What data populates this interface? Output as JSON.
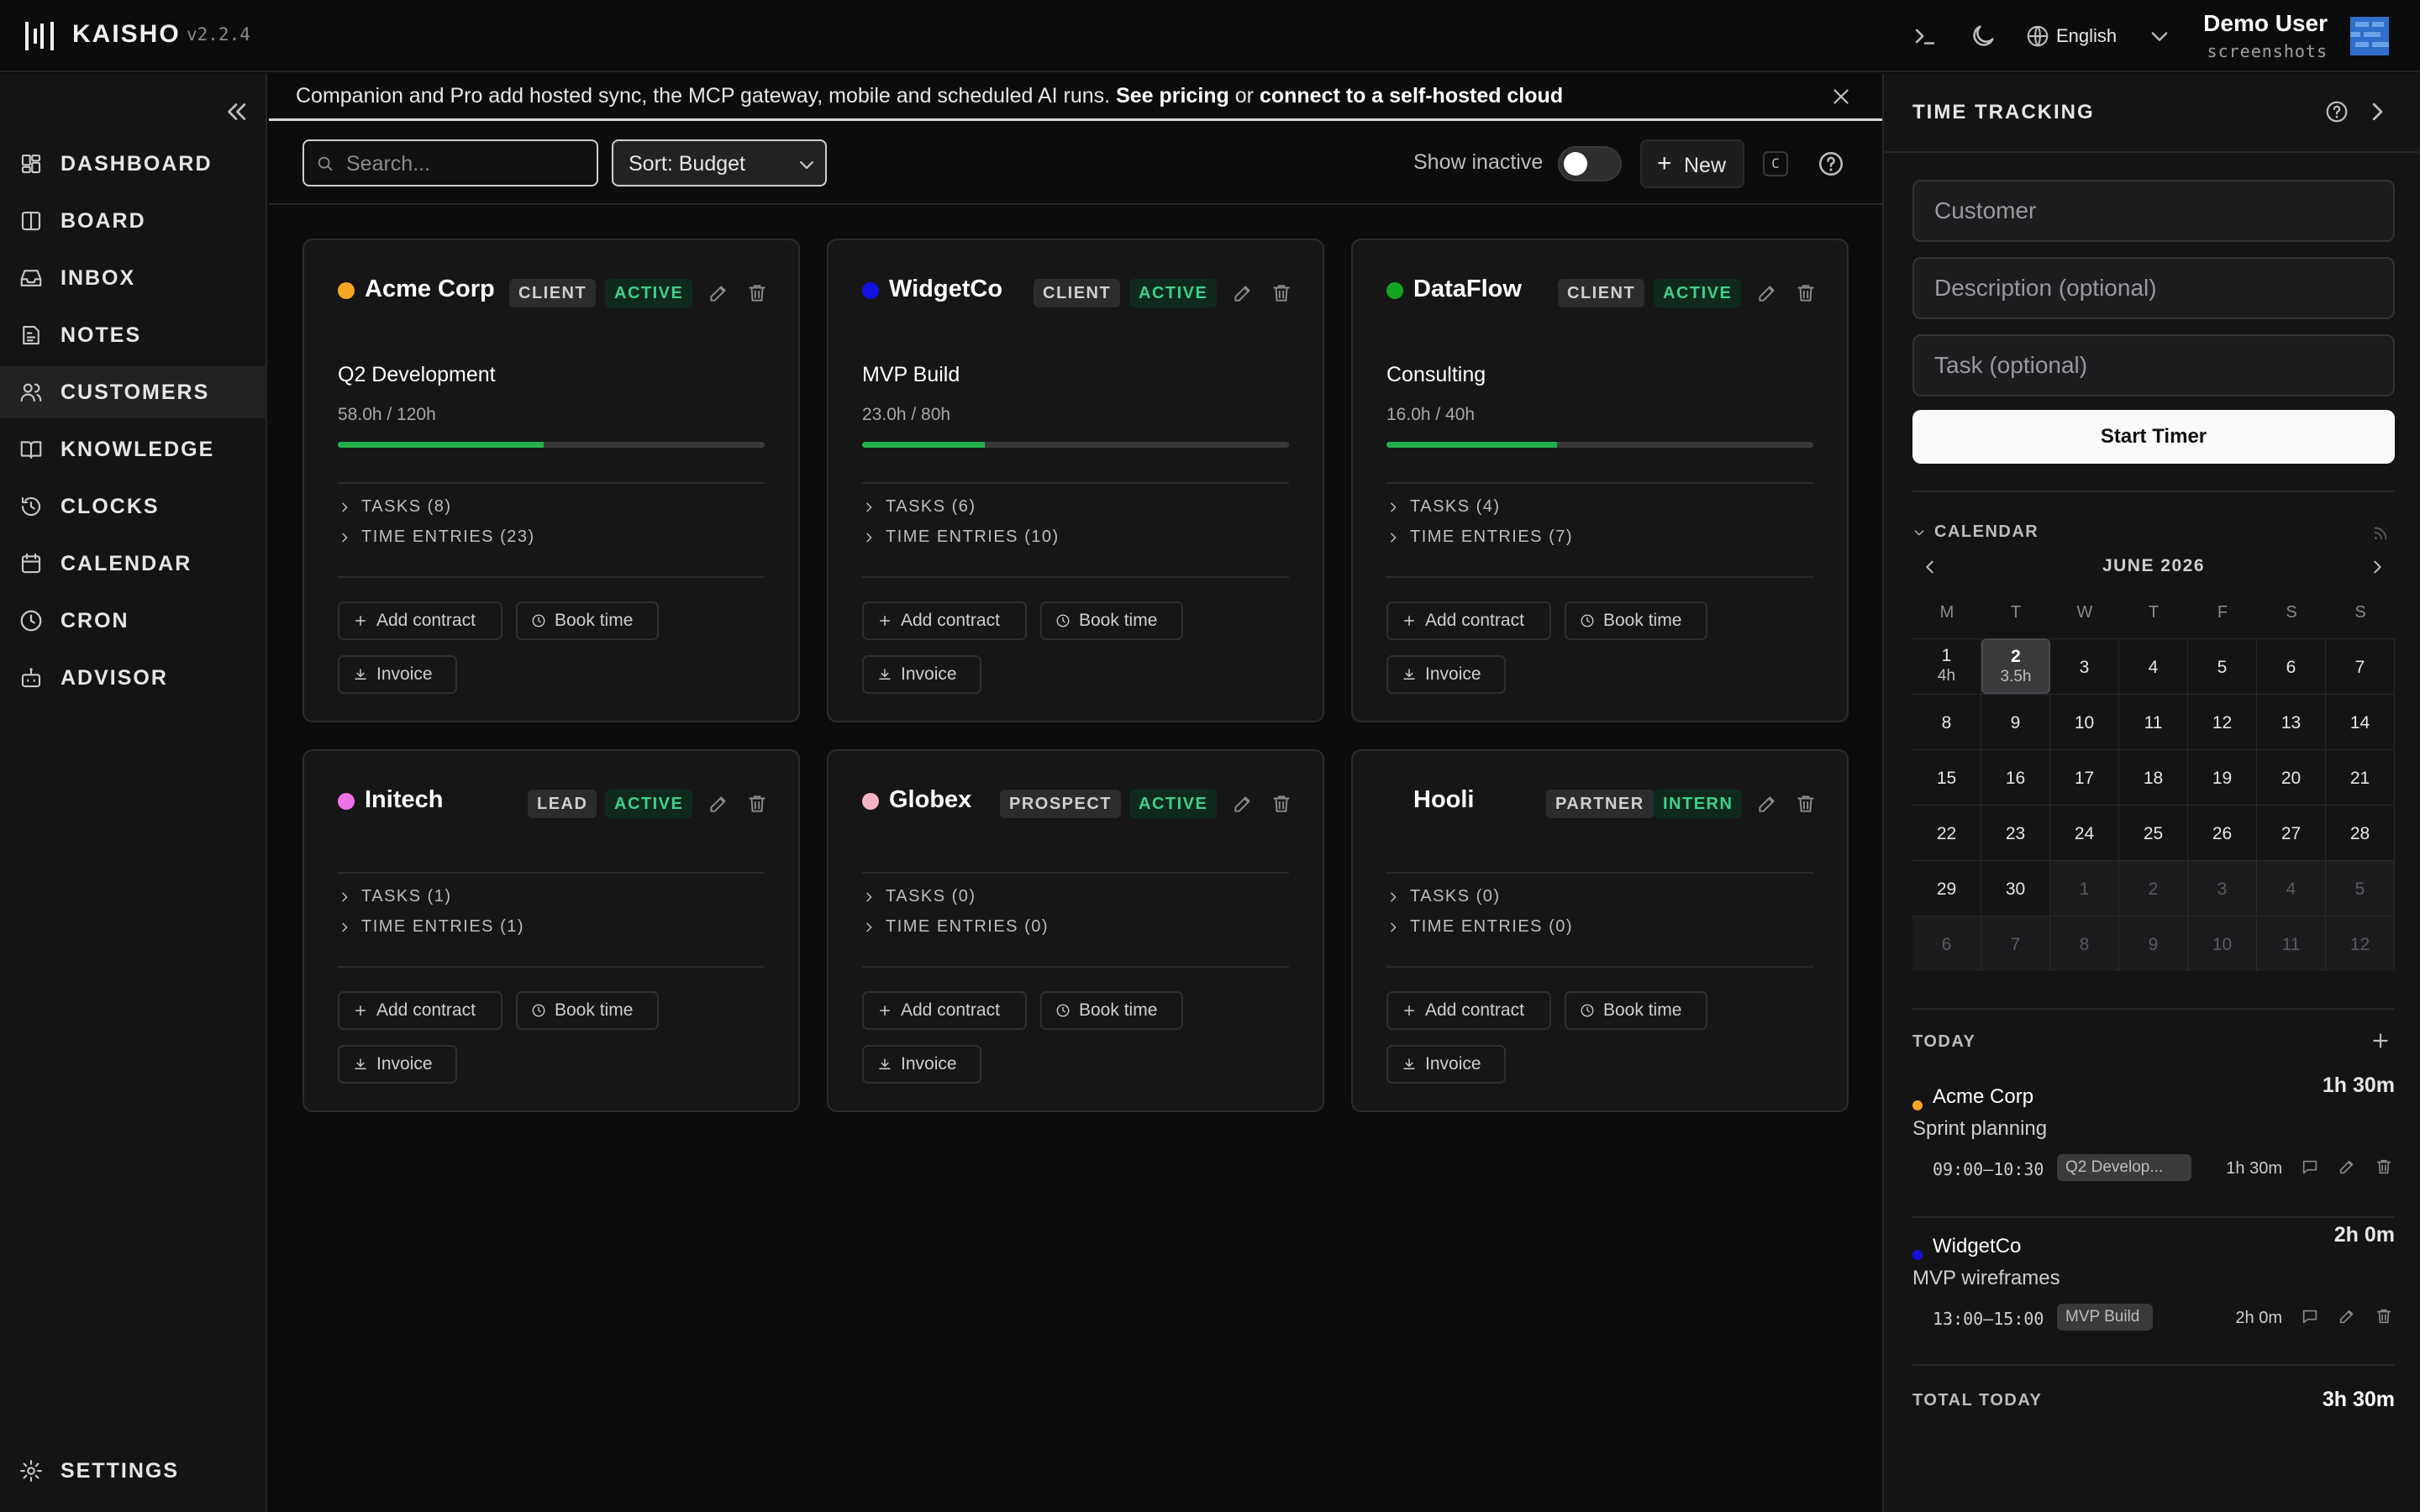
{
  "app": {
    "name": "KAISHO",
    "version": "v2.2.4"
  },
  "topbar": {
    "language": "English",
    "user_name": "Demo User",
    "user_sub": "screenshots"
  },
  "sidebar": {
    "items": [
      {
        "label": "DASHBOARD",
        "icon": "dashboard-icon"
      },
      {
        "label": "BOARD",
        "icon": "board-icon"
      },
      {
        "label": "INBOX",
        "icon": "inbox-icon"
      },
      {
        "label": "NOTES",
        "icon": "notes-icon"
      },
      {
        "label": "CUSTOMERS",
        "icon": "users-icon",
        "active": true
      },
      {
        "label": "KNOWLEDGE",
        "icon": "book-icon"
      },
      {
        "label": "CLOCKS",
        "icon": "history-icon"
      },
      {
        "label": "CALENDAR",
        "icon": "calendar-icon"
      },
      {
        "label": "CRON",
        "icon": "clock-icon"
      },
      {
        "label": "ADVISOR",
        "icon": "bot-icon"
      }
    ],
    "settings": "SETTINGS"
  },
  "banner": {
    "text": "Companion and Pro add hosted sync, the MCP gateway, mobile and scheduled AI runs. ",
    "link1": "See pricing",
    "mid": " or ",
    "link2": "connect to a self-hosted cloud"
  },
  "toolbar": {
    "search_placeholder": "Search...",
    "sort_label": "Sort: Budget",
    "show_inactive": "Show inactive",
    "show_inactive_on": false,
    "new_label": "New",
    "shortcut": "C"
  },
  "customers": [
    {
      "name": "Acme Corp",
      "color": "#f5a623",
      "type": "CLIENT",
      "status": "ACTIVE",
      "contract": {
        "title": "Q2 Development",
        "hours": "58.0h / 120h",
        "progress": 0.483
      },
      "tasks": "TASKS (8)",
      "entries": "TIME ENTRIES (23)"
    },
    {
      "name": "WidgetCo",
      "color": "#1212e0",
      "type": "CLIENT",
      "status": "ACTIVE",
      "contract": {
        "title": "MVP Build",
        "hours": "23.0h / 80h",
        "progress": 0.2875
      },
      "tasks": "TASKS (6)",
      "entries": "TIME ENTRIES (10)"
    },
    {
      "name": "DataFlow",
      "color": "#13a51f",
      "type": "CLIENT",
      "status": "ACTIVE",
      "contract": {
        "title": "Consulting",
        "hours": "16.0h / 40h",
        "progress": 0.4
      },
      "tasks": "TASKS (4)",
      "entries": "TIME ENTRIES (7)"
    },
    {
      "name": "Initech",
      "color": "#ee72e6",
      "type": "LEAD",
      "status": "ACTIVE",
      "tasks": "TASKS (1)",
      "entries": "TIME ENTRIES (1)"
    },
    {
      "name": "Globex",
      "color": "#f5b4c4",
      "type": "PROSPECT",
      "status": "ACTIVE",
      "tasks": "TASKS (0)",
      "entries": "TIME ENTRIES (0)"
    },
    {
      "name": "Hooli",
      "color": "",
      "type": "PARTNER",
      "status": "INTERN",
      "tasks": "TASKS (0)",
      "entries": "TIME ENTRIES (0)"
    }
  ],
  "card_actions": {
    "add_contract": "Add contract",
    "book_time": "Book time",
    "invoice": "Invoice"
  },
  "time_tracking": {
    "title": "TIME TRACKING",
    "customer_placeholder": "Customer",
    "description_placeholder": "Description (optional)",
    "task_placeholder": "Task (optional)",
    "start_label": "Start Timer"
  },
  "calendar": {
    "heading": "CALENDAR",
    "month": "JUNE 2026",
    "weekdays": [
      "M",
      "T",
      "W",
      "T",
      "F",
      "S",
      "S"
    ],
    "weeks": [
      [
        {
          "d": "1",
          "h": "4h"
        },
        {
          "d": "2",
          "h": "3.5h",
          "sel": true
        },
        {
          "d": "3"
        },
        {
          "d": "4"
        },
        {
          "d": "5"
        },
        {
          "d": "6"
        },
        {
          "d": "7"
        }
      ],
      [
        {
          "d": "8"
        },
        {
          "d": "9"
        },
        {
          "d": "10"
        },
        {
          "d": "11"
        },
        {
          "d": "12"
        },
        {
          "d": "13"
        },
        {
          "d": "14"
        }
      ],
      [
        {
          "d": "15"
        },
        {
          "d": "16"
        },
        {
          "d": "17"
        },
        {
          "d": "18"
        },
        {
          "d": "19"
        },
        {
          "d": "20"
        },
        {
          "d": "21"
        }
      ],
      [
        {
          "d": "22"
        },
        {
          "d": "23"
        },
        {
          "d": "24"
        },
        {
          "d": "25"
        },
        {
          "d": "26"
        },
        {
          "d": "27"
        },
        {
          "d": "28"
        }
      ],
      [
        {
          "d": "29"
        },
        {
          "d": "30"
        },
        {
          "d": "1",
          "o": true
        },
        {
          "d": "2",
          "o": true
        },
        {
          "d": "3",
          "o": true
        },
        {
          "d": "4",
          "o": true
        },
        {
          "d": "5",
          "o": true
        }
      ],
      [
        {
          "d": "6",
          "o": true
        },
        {
          "d": "7",
          "o": true
        },
        {
          "d": "8",
          "o": true
        },
        {
          "d": "9",
          "o": true
        },
        {
          "d": "10",
          "o": true
        },
        {
          "d": "11",
          "o": true
        },
        {
          "d": "12",
          "o": true
        }
      ]
    ]
  },
  "today": {
    "heading": "TODAY",
    "entries": [
      {
        "customer": "Acme Corp",
        "color": "#f5a623",
        "total": "1h 30m",
        "description": "Sprint planning",
        "time": "09:00–10:30",
        "contract": "Q2 Develop...",
        "duration": "1h 30m"
      },
      {
        "customer": "WidgetCo",
        "color": "#1212e0",
        "total": "2h 0m",
        "description": "MVP wireframes",
        "time": "13:00–15:00",
        "contract": "MVP Build",
        "duration": "2h 0m"
      }
    ],
    "total_label": "TOTAL TODAY",
    "total_value": "3h 30m"
  }
}
